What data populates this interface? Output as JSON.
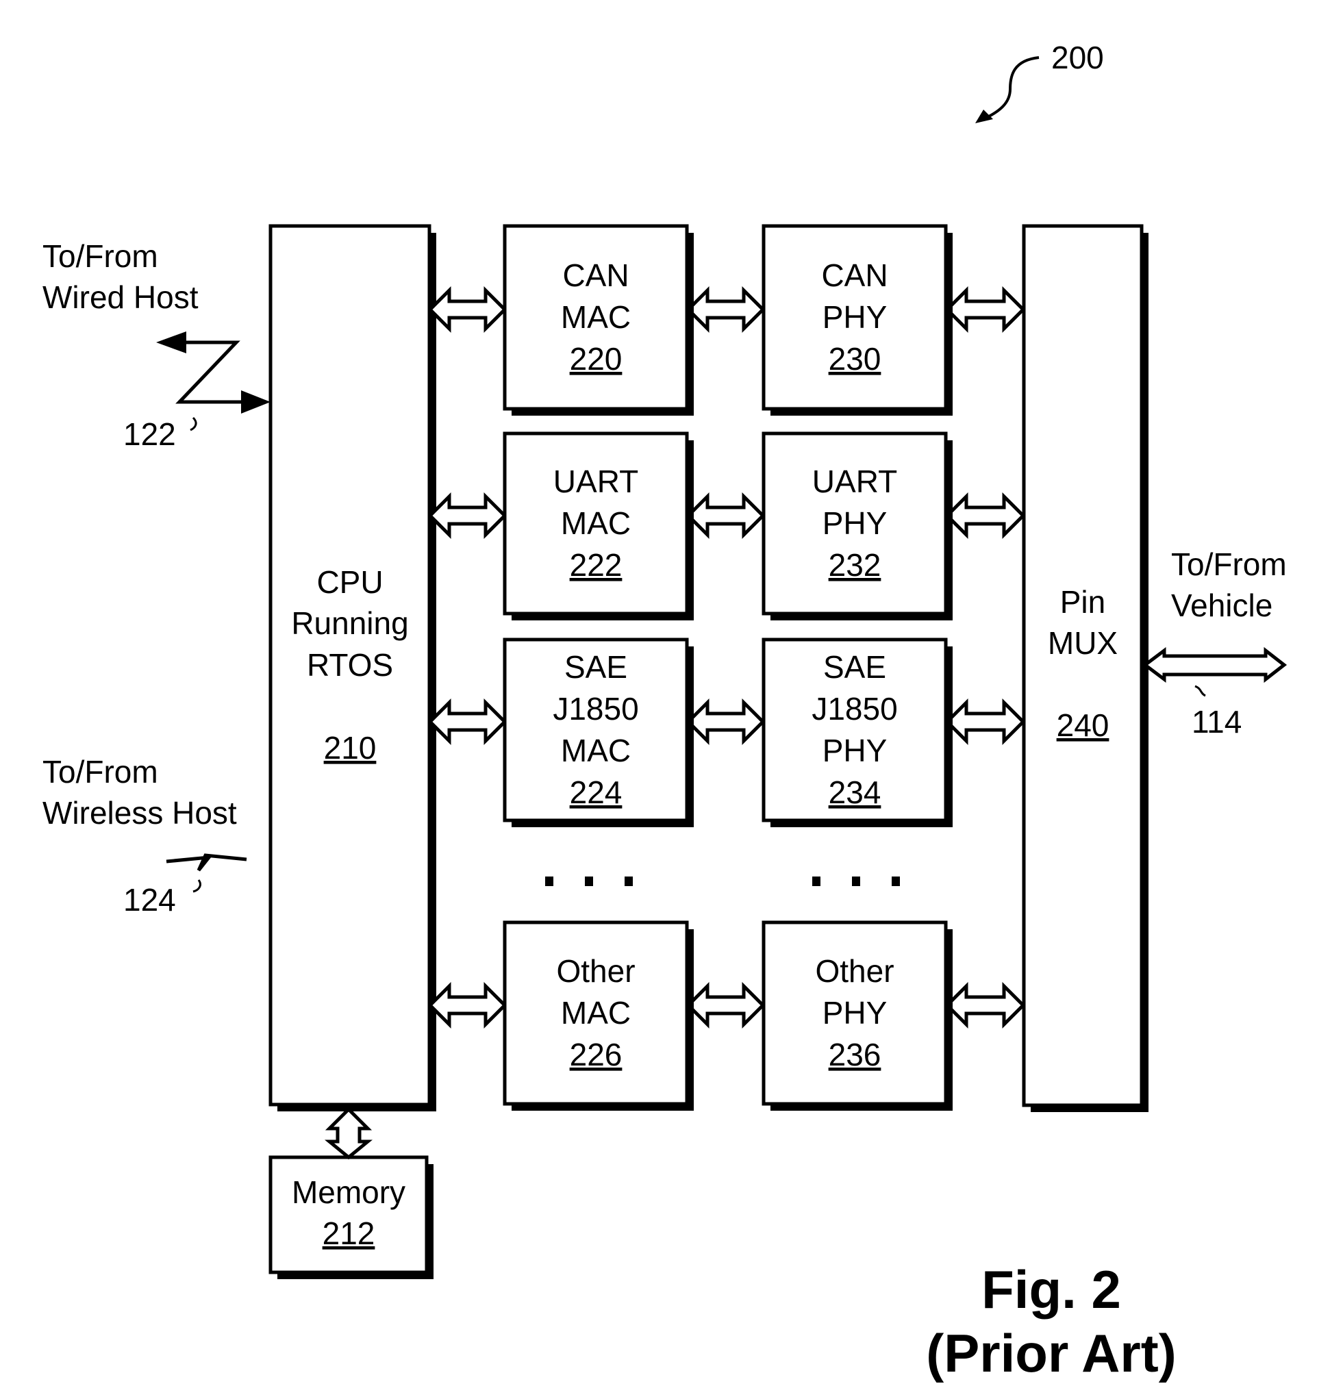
{
  "figure": {
    "ref_number": "200",
    "caption_line1": "Fig. 2",
    "caption_line2": "(Prior Art)"
  },
  "external": {
    "wired_host": {
      "line1": "To/From",
      "line2": "Wired Host",
      "ref": "122"
    },
    "wireless_host": {
      "line1": "To/From",
      "line2": "Wireless Host",
      "ref": "124"
    },
    "vehicle": {
      "line1": "To/From",
      "line2": "Vehicle",
      "ref": "114"
    }
  },
  "cpu": {
    "lines": [
      "CPU",
      "Running",
      "RTOS"
    ],
    "ref": "210"
  },
  "memory": {
    "label": "Memory",
    "ref": "212"
  },
  "pin_mux": {
    "lines": [
      "Pin",
      "MUX"
    ],
    "ref": "240"
  },
  "mac_blocks": [
    {
      "lines": [
        "CAN",
        "MAC"
      ],
      "ref": "220"
    },
    {
      "lines": [
        "UART",
        "MAC"
      ],
      "ref": "222"
    },
    {
      "lines": [
        "SAE",
        "J1850",
        "MAC"
      ],
      "ref": "224"
    },
    {
      "lines": [
        "Other",
        "MAC"
      ],
      "ref": "226"
    }
  ],
  "phy_blocks": [
    {
      "lines": [
        "CAN",
        "PHY"
      ],
      "ref": "230"
    },
    {
      "lines": [
        "UART",
        "PHY"
      ],
      "ref": "232"
    },
    {
      "lines": [
        "SAE",
        "J1850",
        "PHY"
      ],
      "ref": "234"
    },
    {
      "lines": [
        "Other",
        "PHY"
      ],
      "ref": "236"
    }
  ],
  "ellipsis": "..."
}
